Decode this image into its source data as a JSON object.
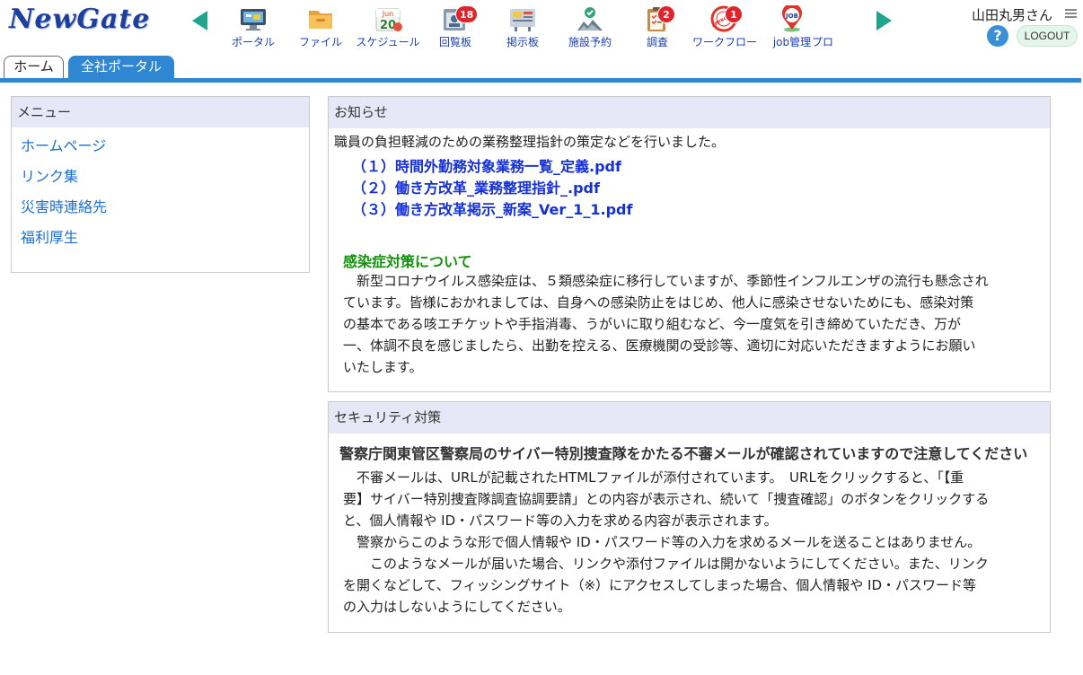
{
  "header": {
    "logo": "NewGate",
    "user_name": "山田丸男さん",
    "help": "?",
    "logout": "LOGOUT"
  },
  "nav": {
    "items": [
      {
        "label": "ポータル",
        "icon": "portal-monitor-icon"
      },
      {
        "label": "ファイル",
        "icon": "folder-icon"
      },
      {
        "label": "スケジュール",
        "icon": "calendar-icon",
        "calendar_month": "Jun",
        "calendar_day": "20"
      },
      {
        "label": "回覧板",
        "icon": "circular-board-icon",
        "badge": "18"
      },
      {
        "label": "掲示板",
        "icon": "bulletin-board-icon"
      },
      {
        "label": "施設予約",
        "icon": "facility-reservation-icon"
      },
      {
        "label": "調査",
        "icon": "survey-clipboard-icon",
        "badge": "2"
      },
      {
        "label": "ワークフロー",
        "icon": "approved-stamp-icon",
        "badge": "1",
        "stamp_text": "APPROVED"
      },
      {
        "label": "job管理",
        "icon": "job-pin-icon",
        "pin_text": "JOB"
      },
      {
        "label": "プロ",
        "icon": "more-icon"
      }
    ]
  },
  "tabs": {
    "home": "ホーム",
    "portal": "全社ポータル"
  },
  "menu": {
    "title": "メニュー",
    "links": [
      "ホームページ",
      "リンク集",
      "災害時連絡先",
      "福利厚生"
    ]
  },
  "notice": {
    "title": "お知らせ",
    "intro": "職員の負担軽減のための業務整理指針の策定などを行いました。",
    "files": [
      "（１）時間外勤務対象業務一覧_定義.pdf",
      "（２）働き方改革_業務整理指針_.pdf",
      "（３）働き方改革掲示_新案_Ver_1_1.pdf"
    ],
    "infection_title": "感染症対策について",
    "infection_lines": [
      "　新型コロナウイルス感染症は、５類感染症に移行していますが、季節性インフルエンザの流行も懸念され",
      "ています。皆様におかれましては、自身への感染防止をはじめ、他人に感染させないためにも、感染対策",
      "の基本である咳エチケットや手指消毒、うがいに取り組むなど、今一度気を引き締めていただき、万が",
      "一、体調不良を感じましたら、出勤を控える、医療機関の受診等、適切に対応いただきますようにお願い",
      "いたします。"
    ]
  },
  "security": {
    "title": "セキュリティ対策",
    "headline": "警察庁関東管区警察局のサイバー特別捜査隊をかたる不審メールが確認されていますので注意してください",
    "lines": [
      "　不審メールは、URLが記載されたHTMLファイルが添付されています。　URLをクリックすると、「【重",
      "要】サイバー特別捜査隊調査協調要請」との内容が表示され、続いて「捜査確認」のボタンをクリックする",
      "と、個人情報や ID・パスワード等の入力を求める内容が表示されます。",
      "　警察からこのような形で個人情報や ID・パスワード等の入力を求めるメールを送ることはありません。",
      "　　このようなメールが届いた場合、リンクや添付ファイルは開かないようにしてください。また、リンク",
      "を開くなどして、フィッシングサイト（※）にアクセスしてしまった場合、個人情報や ID・パスワード等",
      "の入力はしないようにしてください。"
    ]
  }
}
